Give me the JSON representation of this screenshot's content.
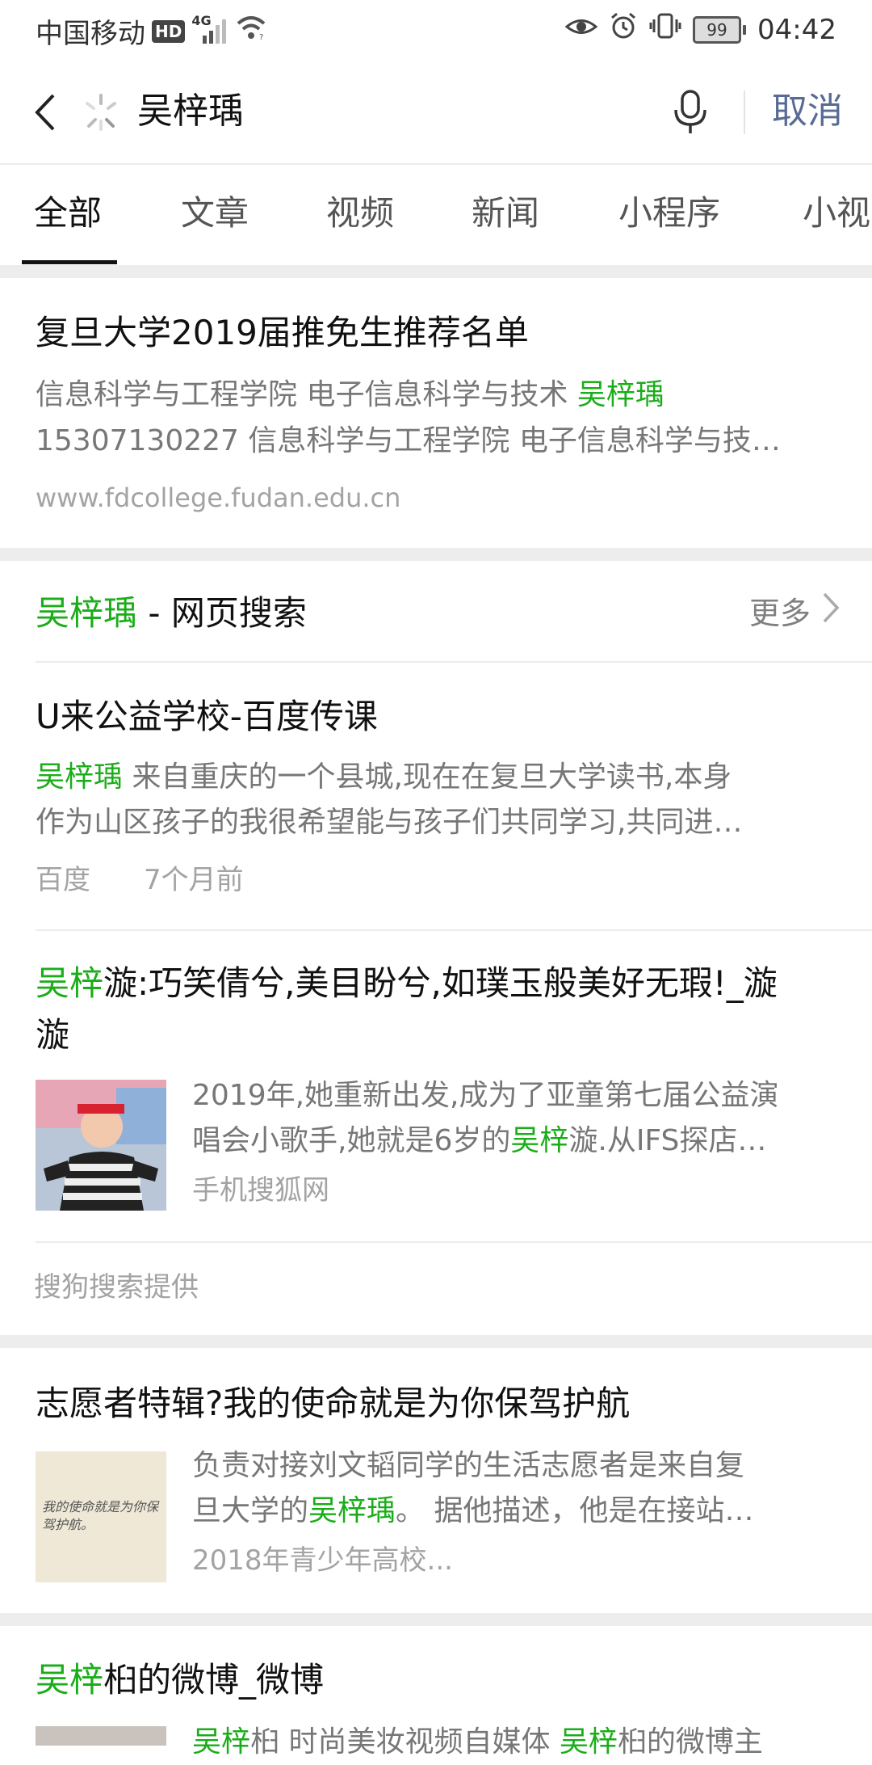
{
  "status_bar": {
    "carrier": "中国移动",
    "hd": "HD",
    "network": "4G",
    "battery": "99",
    "time": "04:42"
  },
  "search": {
    "query": "吴梓瑀",
    "cancel": "取消"
  },
  "tabs": [
    "全部",
    "文章",
    "视频",
    "新闻",
    "小程序",
    "小视"
  ],
  "result1": {
    "title": "复旦大学2019届推免生推荐名单",
    "line1_text": "信息科学与工程学院 电子信息科学与技术 ",
    "line1_hl": "吴梓瑀",
    "line2": "15307130227 信息科学与工程学院 电子信息科学与技…",
    "url": "www.fdcollege.fudan.edu.cn"
  },
  "web_section": {
    "name_hl": "吴梓瑀",
    "heading_rest": " - 网页搜索",
    "more": "更多",
    "item1": {
      "title": "U来公益学校-百度传课",
      "line1_hl": "吴梓瑀",
      "line1_rest": " 来自重庆的一个县城,现在在复旦大学读书,本身",
      "line2": "作为山区孩子的我很希望能与孩子们共同学习,共同进…",
      "source": "百度",
      "time": "7个月前"
    },
    "item2": {
      "title_hl": "吴梓",
      "title_rest": "漩:巧笑倩兮,美目盼兮,如璞玉般美好无瑕!_漩",
      "title_line2": "漩",
      "snippet_line1": "2019年,她重新出发,成为了亚童第七届公益演",
      "snippet_line2_a": "唱会小歌手,她就是6岁的",
      "snippet_line2_hl": "吴梓",
      "snippet_line2_b": "漩.从IFS探店…",
      "source": "手机搜狐网"
    },
    "provider": "搜狗搜索提供"
  },
  "result3": {
    "title": "志愿者特辑?我的使命就是为你保驾护航",
    "line1": "负责对接刘文韬同学的生活志愿者是来自复",
    "line2_a": "旦大学的",
    "line2_hl": "吴梓瑀",
    "line2_b": "。 据他描述，他是在接站…",
    "line3": "2018年青少年高校...",
    "thumb_text": "我的使命就是为你保驾护航。"
  },
  "result4": {
    "title_hl": "吴梓",
    "title_rest": "桕的微博_微博",
    "line1_hl1": "吴梓",
    "line1_a": "桕 时尚美妆视频自媒体 ",
    "line1_hl2": "吴梓",
    "line1_b": "桕的微博主"
  },
  "colors": {
    "highlight": "#1aad19",
    "cancel": "#576b95",
    "separator": "#ededed"
  }
}
